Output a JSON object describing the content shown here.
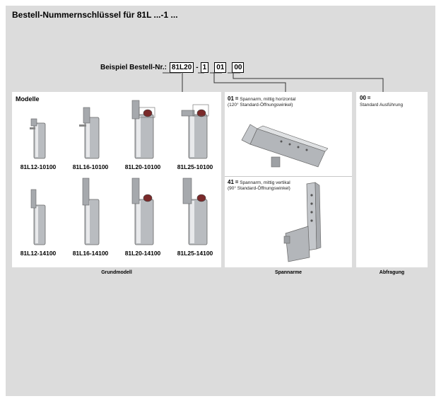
{
  "title": "Bestell-Nummernschlüssel für 81L ...-1 ...",
  "example": {
    "label": "Beispiel Bestell-Nr.:",
    "parts": [
      "81L20",
      "-",
      "1",
      "01",
      "00"
    ]
  },
  "models": {
    "heading": "Modelle",
    "items": [
      {
        "label": "81L12-10100"
      },
      {
        "label": "81L16-10100"
      },
      {
        "label": "81L20-10100"
      },
      {
        "label": "81L25-10100"
      },
      {
        "label": "81L12-14100"
      },
      {
        "label": "81L16-14100"
      },
      {
        "label": "81L20-14100"
      },
      {
        "label": "81L25-14100"
      }
    ],
    "caption": "Grundmodell"
  },
  "arms": {
    "items": [
      {
        "code": "01",
        "eq": "=",
        "desc": "Spannarm, mittig horizontal",
        "note": "(120° Standard-Öffnungswinkel)"
      },
      {
        "code": "41",
        "eq": "=",
        "desc": "Spannarm, mittig vertikal",
        "note": "(90° Standard-Öffnungswinkel)"
      }
    ],
    "caption": "Spannarme"
  },
  "query": {
    "code": "00",
    "eq": "=",
    "desc": "Standard Ausführung",
    "caption": "Abfragung"
  },
  "colors": {
    "background": "#dcdcdc",
    "panel": "#ffffff",
    "metal": "#b9bcc0",
    "indicator": "#7a2a2a"
  }
}
